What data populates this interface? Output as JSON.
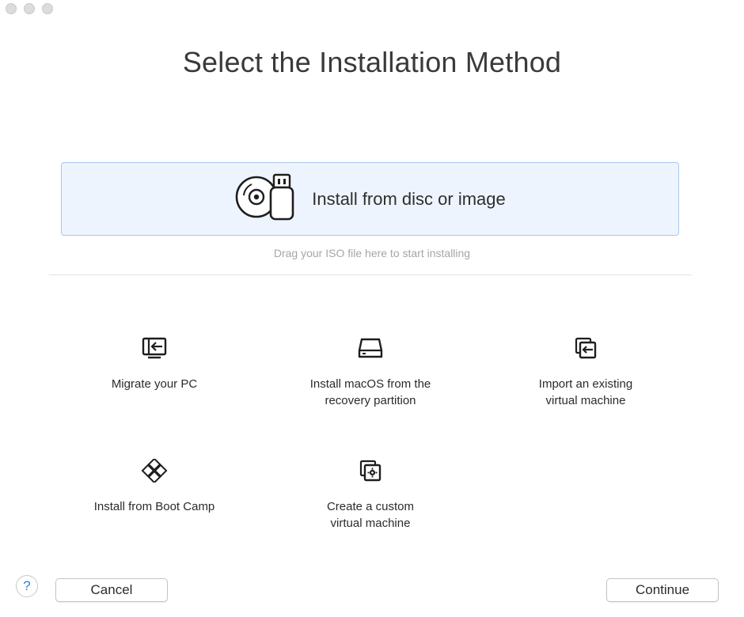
{
  "window": {
    "title": "Select the Installation Method"
  },
  "drop_zone": {
    "label": "Install from disc or image",
    "icon": "disc-usb-icon",
    "hint": "Drag your ISO file here to start installing",
    "accent_color": "#eef4fe",
    "border_color": "#a9c7ee"
  },
  "options": [
    {
      "label": "Migrate your PC",
      "icon": "migrate-pc-icon"
    },
    {
      "label": "Install macOS from the\nrecovery partition",
      "icon": "drive-icon"
    },
    {
      "label": "Import an existing\nvirtual machine",
      "icon": "import-vm-icon"
    },
    {
      "label": "Install from Boot Camp",
      "icon": "boot-camp-icon"
    },
    {
      "label": "Create a custom\nvirtual machine",
      "icon": "custom-vm-icon"
    }
  ],
  "footer": {
    "help_label": "?",
    "cancel_label": "Cancel",
    "continue_label": "Continue",
    "help_color": "#2f7de1"
  }
}
